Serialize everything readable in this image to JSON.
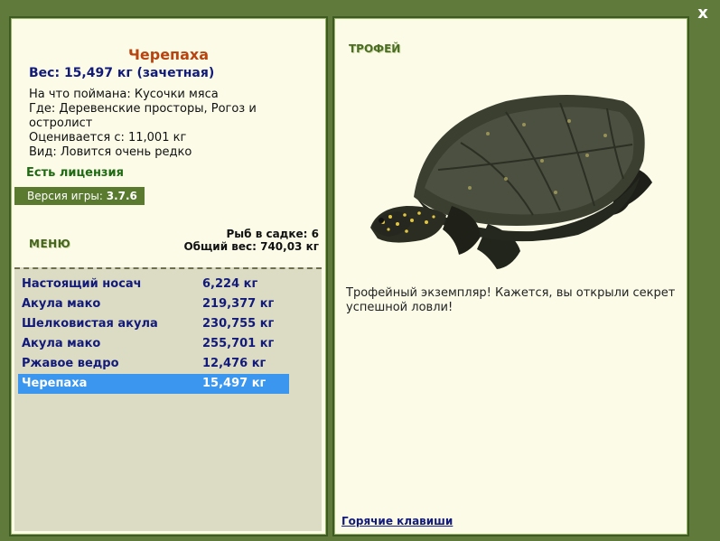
{
  "window": {
    "close_label": "x"
  },
  "fish": {
    "title": "Черепаха",
    "weight": "Вес: 15,497 кг (зачетная)",
    "bait": "На что поймана: Кусочки мяса",
    "where": "Где: Деревенские просторы, Рогоз и остролист",
    "price": "Оценивается с: 11,001 кг",
    "rarity": "Вид: Ловится очень редко"
  },
  "license_text": "Есть лицензия",
  "version": {
    "label": "Версия игры:",
    "value": "3.7.6"
  },
  "menu_label": "МЕНЮ",
  "stats": {
    "count": "Рыб в садке: 6",
    "total_weight": "Общий вес: 740,03 кг"
  },
  "catch_list": [
    {
      "name": "Настоящий носач",
      "weight": "6,224 кг"
    },
    {
      "name": "Акула мако",
      "weight": "219,377 кг"
    },
    {
      "name": "Шелковистая акула",
      "weight": "230,755 кг"
    },
    {
      "name": "Акула мако",
      "weight": "255,701 кг"
    },
    {
      "name": "Ржавое ведро",
      "weight": "12,476 кг"
    },
    {
      "name": "Черепаха",
      "weight": "15,497 кг",
      "selected": true
    }
  ],
  "trophy": {
    "label": "ТРОФЕЙ",
    "description": "Трофейный экземпляр! Кажется, вы открыли секрет успешной ловли!",
    "image_icon": "turtle-image"
  },
  "hotkeys_label": "Горячие клавиши",
  "colors": {
    "background": "#5f7a3a",
    "panel": "#fbfbe8",
    "title": "#b8440f",
    "selected_row": "#3a96ee",
    "text_blue": "#121a7a",
    "license_green": "#1e6a12"
  }
}
